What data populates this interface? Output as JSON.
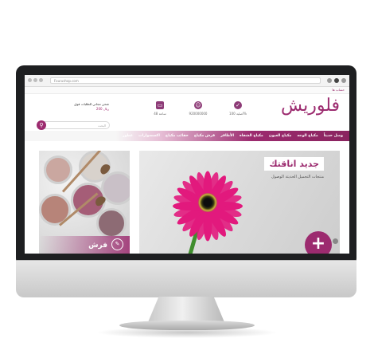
{
  "browser": {
    "url": "Fourushop.com"
  },
  "topbar": {
    "account": "حساب ها"
  },
  "header": {
    "logo": "فلوريش",
    "features": [
      {
        "icon": "check-badge-icon",
        "label": "أصلية 100%"
      },
      {
        "icon": "support-agent-icon",
        "label": "920000000"
      },
      {
        "icon": "delivery-truck-icon",
        "label": "48 ساعة"
      }
    ],
    "promo_line1": "شحن مجاني للطلبات فوق",
    "promo_line2": "200 ريال",
    "search_placeholder": "البحث"
  },
  "nav": {
    "items": [
      "وصل حديثاً",
      "مكياج الوجه",
      "مكياج العيون",
      "مكياج الشفاه",
      "الأظافر",
      "فرش مكياج",
      "حقائب مكياج",
      "اكسسوارات",
      "عطور"
    ]
  },
  "hero": {
    "title": "جديد اناقتك",
    "subtitle": "منتجات التجميل الحديثة الوصول",
    "plus": "+"
  },
  "side_banner": {
    "caption": "فرش"
  },
  "colors": {
    "accent": "#9c2b6f",
    "flower": "#e2197d"
  }
}
